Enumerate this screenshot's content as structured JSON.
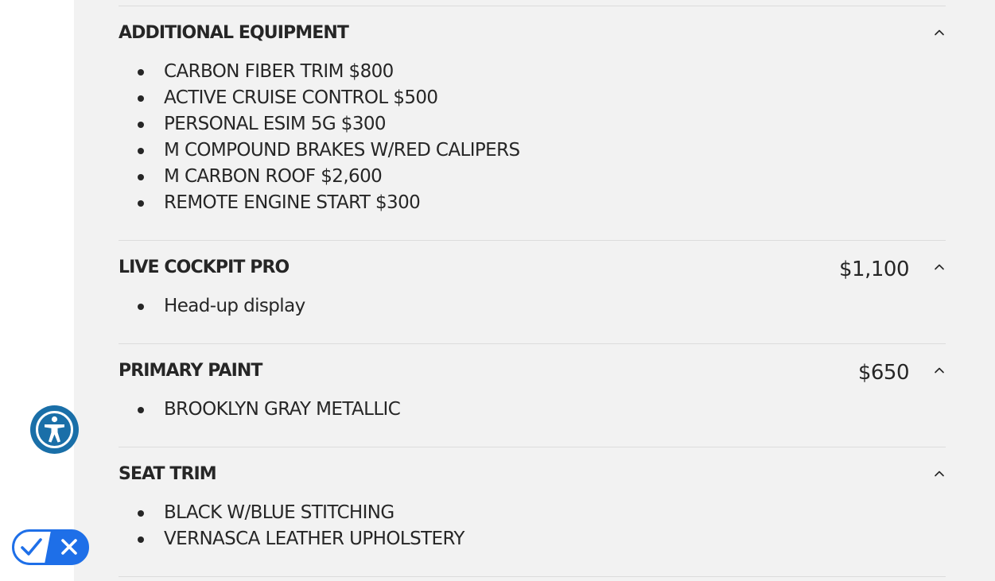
{
  "sections": [
    {
      "title": "ADDITIONAL EQUIPMENT",
      "price": "",
      "items": [
        "CARBON FIBER TRIM $800",
        "ACTIVE CRUISE CONTROL $500",
        "PERSONAL ESIM 5G $300",
        "M COMPOUND BRAKES W/RED CALIPERS",
        "M CARBON ROOF $2,600",
        "REMOTE ENGINE START $300"
      ]
    },
    {
      "title": "LIVE COCKPIT PRO",
      "price": "$1,100",
      "items": [
        "Head-up display"
      ]
    },
    {
      "title": "PRIMARY PAINT",
      "price": "$650",
      "items": [
        "BROOKLYN GRAY METALLIC"
      ]
    },
    {
      "title": "SEAT TRIM",
      "price": "",
      "items": [
        "BLACK W/BLUE STITCHING",
        "VERNASCA LEATHER UPHOLSTERY"
      ]
    }
  ],
  "icons": {
    "collapse": "chevron-up-icon",
    "accessibility": "accessibility-person-icon",
    "consent_check": "checkmark-icon",
    "consent_close": "close-icon"
  },
  "colors": {
    "panel_bg": "#f2f2f2",
    "text": "#262626",
    "divider": "#dcdcdc",
    "accessibility_blue": "#1a6fa8",
    "consent_blue": "#1e6fe8"
  }
}
